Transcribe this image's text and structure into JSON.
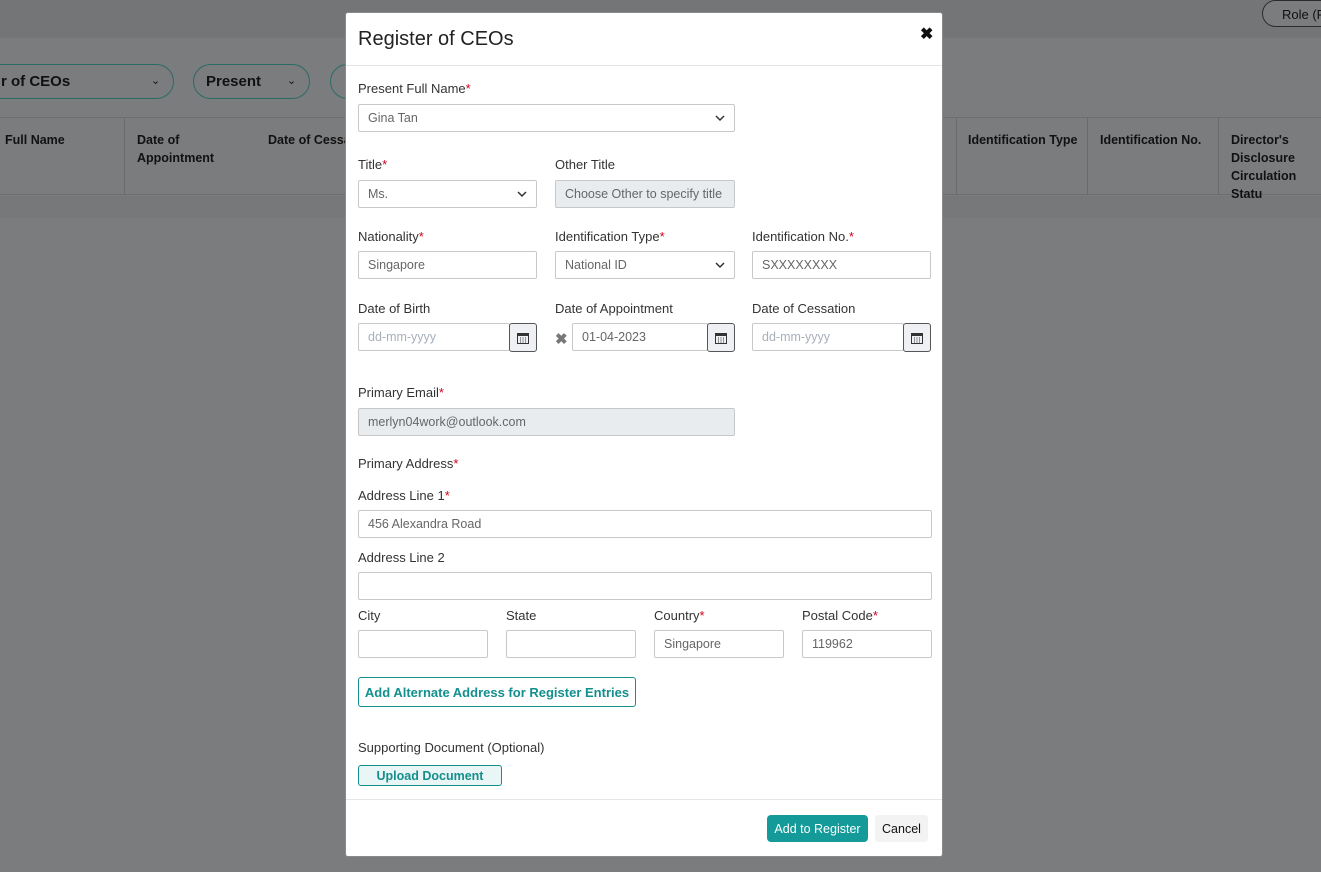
{
  "background": {
    "role_label": "Role (P",
    "filters": [
      {
        "label": "r of CEOs"
      },
      {
        "label": "Present"
      }
    ],
    "table_headers": [
      "Full Name",
      "Date of Appointment",
      "Date of Cessa",
      "Identification Type",
      "Identification No.",
      "Director's Disclosure Circulation Statu"
    ]
  },
  "modal": {
    "title": "Register of CEOs",
    "close_icon": "times-icon",
    "present_full_name": {
      "label": "Present Full Name",
      "value": "Gina Tan"
    },
    "title_field": {
      "label": "Title",
      "value": "Ms."
    },
    "other_title": {
      "label": "Other Title",
      "placeholder": "Choose Other to specify title"
    },
    "nationality": {
      "label": "Nationality",
      "value": "Singapore"
    },
    "identification_type": {
      "label": "Identification Type",
      "value": "National ID"
    },
    "identification_no": {
      "label": "Identification No.",
      "value": "SXXXXXXXX"
    },
    "date_of_birth": {
      "label": "Date of Birth",
      "placeholder": "dd-mm-yyyy"
    },
    "date_of_appointment": {
      "label": "Date of Appointment",
      "value": "01-04-2023"
    },
    "date_of_cessation": {
      "label": "Date of Cessation",
      "placeholder": "dd-mm-yyyy"
    },
    "primary_email": {
      "label": "Primary Email",
      "value": "merlyn04work@outlook.com"
    },
    "primary_address_label": "Primary Address",
    "address_line1": {
      "label": "Address Line 1",
      "value": "456 Alexandra Road"
    },
    "address_line2": {
      "label": "Address Line 2",
      "value": ""
    },
    "city": {
      "label": "City",
      "value": ""
    },
    "state": {
      "label": "State",
      "value": ""
    },
    "country": {
      "label": "Country",
      "value": "Singapore"
    },
    "postal_code": {
      "label": "Postal Code",
      "value": "119962"
    },
    "alt_address_button": "Add Alternate Address for Register Entries",
    "supporting_document_label": "Supporting Document (Optional)",
    "upload_button": "Upload Document",
    "add_button": "Add to Register",
    "cancel_button": "Cancel",
    "required_mark": "*"
  },
  "colors": {
    "accent": "#149a98",
    "required": "#d0021b",
    "overlay": "#7b7c7e"
  }
}
